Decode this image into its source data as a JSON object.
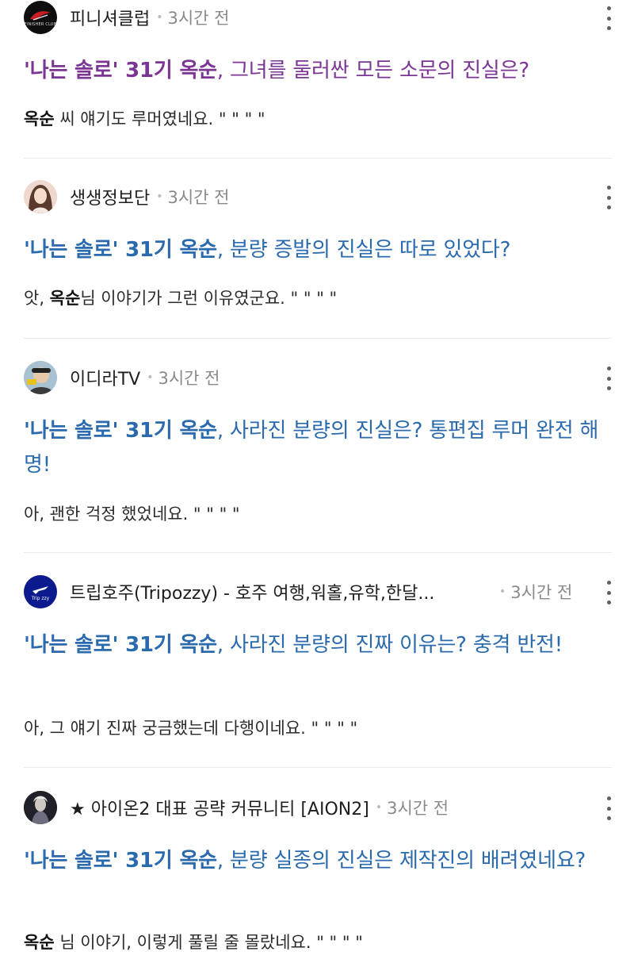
{
  "results": [
    {
      "source": "피니셔클럽",
      "time": "3시간 전",
      "title_highlight": "'나는 솔로' 31기 옥순",
      "title_rest": ", 그녀를 둘러싼 모든 소문의 진실은?",
      "snippet_pre": "",
      "snippet_bold": "옥순",
      "snippet_post": " 씨 얘기도 루머였네요. \" \" \" \"",
      "visited": true
    },
    {
      "source": "생생정보단",
      "time": "3시간 전",
      "title_highlight": "'나는 솔로' 31기 옥순",
      "title_rest": ", 분량 증발의 진실은 따로 있었다?",
      "snippet_pre": "앗, ",
      "snippet_bold": "옥순",
      "snippet_post": "님 이야기가 그런 이유였군요. \" \" \" \"",
      "visited": false
    },
    {
      "source": "이디라TV",
      "time": "3시간 전",
      "title_highlight": "'나는 솔로' 31기 옥순",
      "title_rest": ", 사라진 분량의 진실은? 통편집 루머 완전 해명!",
      "snippet_pre": "아, 괜한 걱정 했었네요. \" \" \" \"",
      "snippet_bold": "",
      "snippet_post": "",
      "visited": false
    },
    {
      "source": "트립호주(Tripozzy) - 호주 여행,워홀,유학,한달...",
      "time": "3시간 전",
      "title_highlight": "'나는 솔로' 31기 옥순",
      "title_rest": ", 사라진 분량의 진짜 이유는? 충격 반전!",
      "snippet_pre": "아, 그 얘기 진짜 궁금했는데 다행이네요. \" \" \" \"",
      "snippet_bold": "",
      "snippet_post": "",
      "visited": false
    },
    {
      "source": "★ 아이온2 대표 공략 커뮤니티 [AION2]",
      "time": "3시간 전",
      "title_highlight": "'나는 솔로' 31기 옥순",
      "title_rest": ", 분량 실종의 진실은 제작진의 배려였네요?",
      "snippet_pre": "",
      "snippet_bold": "옥순",
      "snippet_post": " 님 이야기, 이렇게 풀릴 줄 몰랐네요. \" \" \" \"",
      "visited": false
    }
  ],
  "avatar_text": {
    "r1": "FINISHER CLUB",
    "r4": "Trip zzy"
  },
  "colors": {
    "title_link": "#2a6aad",
    "title_visited": "#7b3593",
    "meta_gray": "#8a8a8a"
  },
  "icons": {
    "more": "vertical-ellipsis-icon"
  }
}
